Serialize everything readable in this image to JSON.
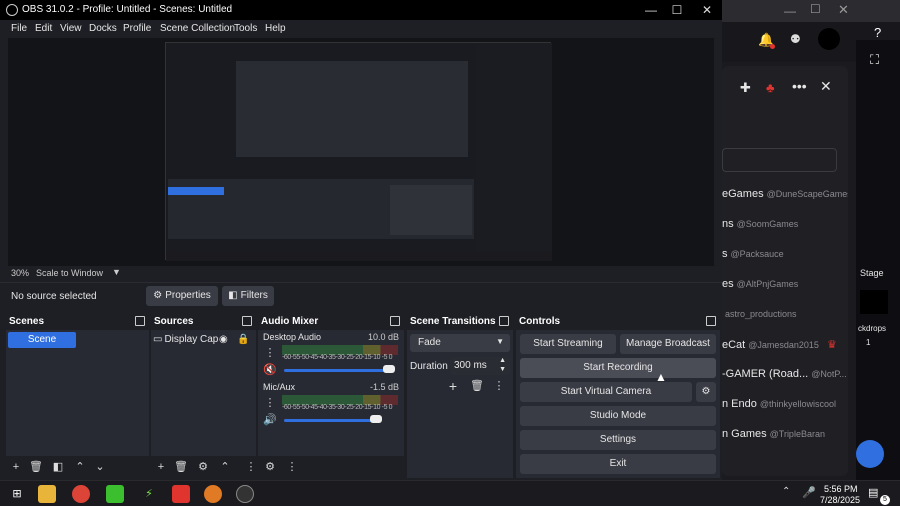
{
  "window": {
    "title": "OBS 31.0.2 - Profile: Untitled - Scenes: Untitled"
  },
  "menu": [
    "File",
    "Edit",
    "View",
    "Docks",
    "Profile",
    "Scene Collection",
    "Tools",
    "Help"
  ],
  "preview": {
    "zoom": "30%",
    "scale_mode": "Scale to Window"
  },
  "source_bar": {
    "status": "No source selected",
    "properties_label": "Properties",
    "filters_label": "Filters"
  },
  "scenes": {
    "title": "Scenes",
    "items": [
      "Scene"
    ]
  },
  "sources": {
    "title": "Sources",
    "items": [
      "Display Cap"
    ]
  },
  "audio": {
    "title": "Audio Mixer",
    "channels": [
      {
        "name": "Desktop Audio",
        "db": "10.0 dB",
        "level": 0.95
      },
      {
        "name": "Mic/Aux",
        "db": "-1.5 dB",
        "level": 0.84
      }
    ],
    "ticks": "-60-55-50-45-40-35-30-25-20-15-10 -5 0"
  },
  "transitions": {
    "title": "Scene Transitions",
    "selected": "Fade",
    "duration_label": "Duration",
    "duration_value": "300 ms"
  },
  "controls": {
    "title": "Controls",
    "start_streaming": "Start Streaming",
    "manage_broadcast": "Manage Broadcast",
    "start_recording": "Start Recording",
    "start_virtual_camera": "Start Virtual Camera",
    "studio_mode": "Studio Mode",
    "settings": "Settings",
    "exit": "Exit"
  },
  "background_app": {
    "users": [
      {
        "name": "eGames",
        "handle": "@DuneScapeGames"
      },
      {
        "name": "ns",
        "handle": "@SoomGames"
      },
      {
        "name": "s",
        "handle": "@Packsauce"
      },
      {
        "name": "es",
        "handle": "@AltPnjGames"
      },
      {
        "name": "",
        "handle": "astro_productions"
      },
      {
        "name": "eCat",
        "handle": "@Jamesdan2015"
      },
      {
        "name": "-GAMER (Road...",
        "handle": "@NotP..."
      },
      {
        "name": "n Endo",
        "handle": "@thinkyellowiscool"
      },
      {
        "name": "n Games",
        "handle": "@TripleBaran"
      }
    ],
    "side_labels": [
      "Stage",
      "ckdrops",
      "1"
    ]
  },
  "taskbar": {
    "time": "5:56 PM",
    "date": "7/28/2025",
    "notif_count": "5"
  },
  "colors": {
    "accent": "#2f6fe0",
    "panel": "#272a33",
    "button": "#3a3c45"
  }
}
